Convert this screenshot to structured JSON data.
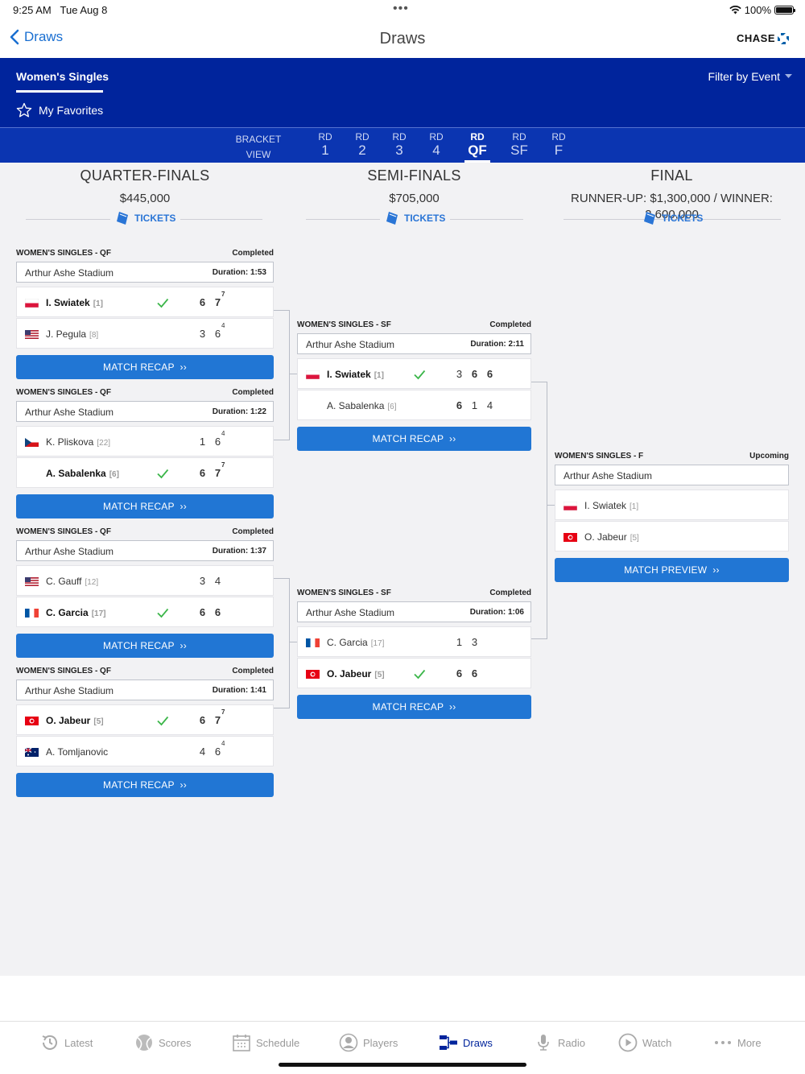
{
  "status": {
    "time": "9:25 AM",
    "date": "Tue Aug 8",
    "battery": "100%",
    "battery_level": 1.0
  },
  "navbar": {
    "back_label": "Draws",
    "title": "Draws",
    "sponsor": "CHASE"
  },
  "header": {
    "event": "Women's Singles",
    "favorites": "My Favorites",
    "filter": "Filter by Event"
  },
  "rounds": {
    "bracket_l1": "BRACKET",
    "bracket_l2": "VIEW",
    "items": [
      {
        "l1": "RD",
        "l2": "1"
      },
      {
        "l1": "RD",
        "l2": "2"
      },
      {
        "l1": "RD",
        "l2": "3"
      },
      {
        "l1": "RD",
        "l2": "4"
      },
      {
        "l1": "RD",
        "l2": "QF"
      },
      {
        "l1": "RD",
        "l2": "SF"
      },
      {
        "l1": "RD",
        "l2": "F"
      }
    ],
    "active": "QF"
  },
  "columns": [
    {
      "name": "QUARTER-FINALS",
      "prize": "$445,000",
      "tickets": "TICKETS"
    },
    {
      "name": "SEMI-FINALS",
      "prize": "$705,000",
      "tickets": "TICKETS"
    },
    {
      "name": "FINAL",
      "prize": "RUNNER-UP: $1,300,000 / WINNER:",
      "prize2": "2,600,000",
      "tickets": "TICKETS"
    }
  ],
  "matches": {
    "qf1": {
      "round": "WOMEN'S SINGLES - QF",
      "status": "Completed",
      "venue": "Arthur Ashe Stadium",
      "duration": "Duration: 1:53",
      "button": "MATCH RECAP",
      "p1": {
        "name": "I. Swiatek",
        "seed": "[1]",
        "flag": "poland",
        "s1": "6",
        "s2": "7",
        "t2": "7"
      },
      "p2": {
        "name": "J. Pegula",
        "seed": "[8]",
        "flag": "usa",
        "s1": "3",
        "s2": "6",
        "t2": "4"
      }
    },
    "qf2": {
      "round": "WOMEN'S SINGLES - QF",
      "status": "Completed",
      "venue": "Arthur Ashe Stadium",
      "duration": "Duration: 1:22",
      "button": "MATCH RECAP",
      "p1": {
        "name": "K. Pliskova",
        "seed": "[22]",
        "flag": "czech",
        "s1": "1",
        "s2": "6",
        "t2": "4"
      },
      "p2": {
        "name": "A. Sabalenka",
        "seed": "[6]",
        "flag": "none",
        "s1": "6",
        "s2": "7",
        "t2": "7"
      }
    },
    "qf3": {
      "round": "WOMEN'S SINGLES - QF",
      "status": "Completed",
      "venue": "Arthur Ashe Stadium",
      "duration": "Duration: 1:37",
      "button": "MATCH RECAP",
      "p1": {
        "name": "C. Gauff",
        "seed": "[12]",
        "flag": "usa",
        "s1": "3",
        "s2": "4"
      },
      "p2": {
        "name": "C. Garcia",
        "seed": "[17]",
        "flag": "france",
        "s1": "6",
        "s2": "6"
      }
    },
    "qf4": {
      "round": "WOMEN'S SINGLES - QF",
      "status": "Completed",
      "venue": "Arthur Ashe Stadium",
      "duration": "Duration: 1:41",
      "button": "MATCH RECAP",
      "p1": {
        "name": "O. Jabeur",
        "seed": "[5]",
        "flag": "tunisia",
        "s1": "6",
        "s2": "7",
        "t2": "7"
      },
      "p2": {
        "name": "A. Tomljanovic",
        "seed": "",
        "flag": "australia",
        "s1": "4",
        "s2": "6",
        "t2": "4"
      }
    },
    "sf1": {
      "round": "WOMEN'S SINGLES - SF",
      "status": "Completed",
      "venue": "Arthur Ashe Stadium",
      "duration": "Duration: 2:11",
      "button": "MATCH RECAP",
      "p1": {
        "name": "I. Swiatek",
        "seed": "[1]",
        "flag": "poland",
        "s1": "3",
        "s2": "6",
        "s3": "6"
      },
      "p2": {
        "name": "A. Sabalenka",
        "seed": "[6]",
        "flag": "none",
        "s1": "6",
        "s2": "1",
        "s3": "4"
      }
    },
    "sf2": {
      "round": "WOMEN'S SINGLES - SF",
      "status": "Completed",
      "venue": "Arthur Ashe Stadium",
      "duration": "Duration: 1:06",
      "button": "MATCH RECAP",
      "p1": {
        "name": "C. Garcia",
        "seed": "[17]",
        "flag": "france",
        "s1": "1",
        "s2": "3"
      },
      "p2": {
        "name": "O. Jabeur",
        "seed": "[5]",
        "flag": "tunisia",
        "s1": "6",
        "s2": "6"
      }
    },
    "f": {
      "round": "WOMEN'S SINGLES - F",
      "status": "Upcoming",
      "venue": "Arthur Ashe Stadium",
      "button": "MATCH PREVIEW",
      "p1": {
        "name": "I. Swiatek",
        "seed": "[1]",
        "flag": "poland"
      },
      "p2": {
        "name": "O. Jabeur",
        "seed": "[5]",
        "flag": "tunisia"
      }
    }
  },
  "tabs": [
    {
      "label": "Latest",
      "icon": "latest-icon"
    },
    {
      "label": "Scores",
      "icon": "tennis-ball-icon"
    },
    {
      "label": "Schedule",
      "icon": "calendar-icon"
    },
    {
      "label": "Players",
      "icon": "player-icon"
    },
    {
      "label": "Draws",
      "icon": "draws-icon"
    },
    {
      "label": "Radio",
      "icon": "microphone-icon"
    },
    {
      "label": "Watch",
      "icon": "play-icon"
    },
    {
      "label": "More",
      "icon": "more-dots-icon"
    }
  ],
  "active_tab": "Draws",
  "colors": {
    "brand_blue": "#00249c",
    "button_blue": "#2176d4",
    "link_blue": "#1a6fd1",
    "check_green": "#3cb64a"
  }
}
